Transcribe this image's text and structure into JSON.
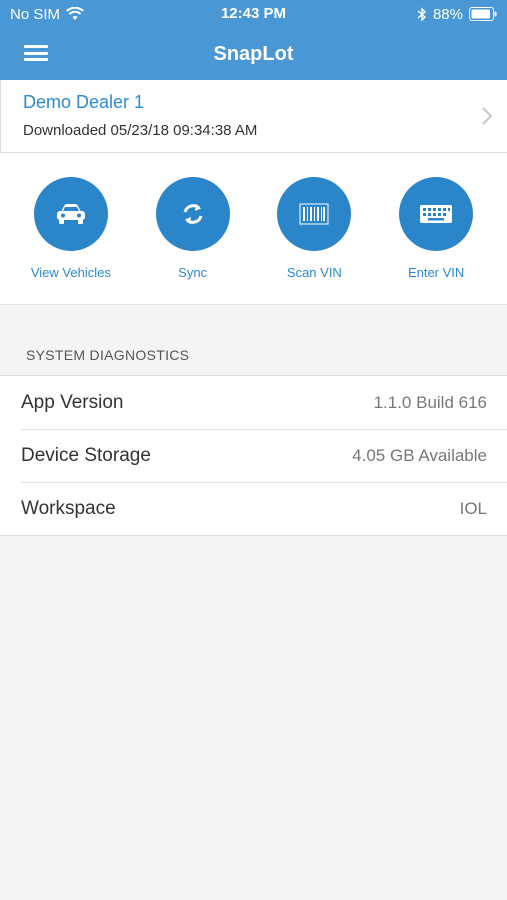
{
  "status_bar": {
    "carrier": "No SIM",
    "time": "12:43 PM",
    "battery": "88%"
  },
  "nav": {
    "title": "SnapLot"
  },
  "dealer": {
    "name": "Demo Dealer 1",
    "downloaded": "Downloaded 05/23/18 09:34:38 AM"
  },
  "actions": [
    {
      "label": "View Vehicles",
      "icon": "car-icon"
    },
    {
      "label": "Sync",
      "icon": "sync-icon"
    },
    {
      "label": "Scan VIN",
      "icon": "barcode-icon"
    },
    {
      "label": "Enter VIN",
      "icon": "keyboard-icon"
    }
  ],
  "diagnostics": {
    "title": "SYSTEM DIAGNOSTICS",
    "rows": [
      {
        "label": "App Version",
        "value": "1.1.0 Build 616"
      },
      {
        "label": "Device Storage",
        "value": "4.05 GB Available"
      },
      {
        "label": "Workspace",
        "value": "IOL"
      }
    ]
  },
  "colors": {
    "header": "#4a97d6",
    "accent": "#2a86c9",
    "link": "#2a8bcf"
  }
}
